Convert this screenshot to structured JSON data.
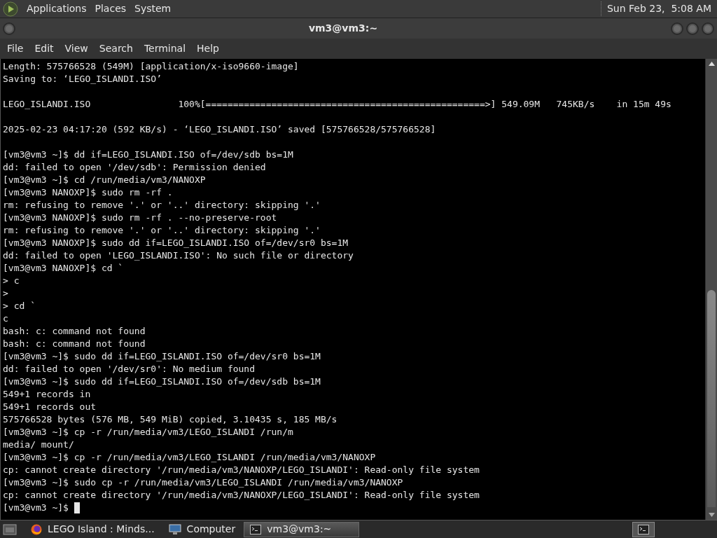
{
  "top_panel": {
    "menus": [
      "Applications",
      "Places",
      "System"
    ],
    "clock": "Sun Feb 23,  5:08 AM"
  },
  "window": {
    "title": "vm3@vm3:~"
  },
  "menu_bar": [
    "File",
    "Edit",
    "View",
    "Search",
    "Terminal",
    "Help"
  ],
  "terminal": {
    "lines": [
      {
        "kind": "text",
        "text": "Length: 575766528 (549M) [application/x-iso9660-image]"
      },
      {
        "kind": "text",
        "text": "Saving to: ‘LEGO_ISLANDI.ISO’"
      },
      {
        "kind": "blank"
      },
      {
        "kind": "text",
        "text": "LEGO_ISLANDI.ISO                100%[===================================================>] 549.09M   745KB/s    in 15m 49s"
      },
      {
        "kind": "blank"
      },
      {
        "kind": "text",
        "text": "2025-02-23 04:17:20 (592 KB/s) - ‘LEGO_ISLANDI.ISO’ saved [575766528/575766528]"
      },
      {
        "kind": "blank"
      },
      {
        "kind": "text",
        "text": "[vm3@vm3 ~]$ dd if=LEGO_ISLANDI.ISO of=/dev/sdb bs=1M"
      },
      {
        "kind": "text",
        "text": "dd: failed to open '/dev/sdb': Permission denied"
      },
      {
        "kind": "text",
        "text": "[vm3@vm3 ~]$ cd /run/media/vm3/NANOXP"
      },
      {
        "kind": "text",
        "text": "[vm3@vm3 NANOXP]$ sudo rm -rf ."
      },
      {
        "kind": "text",
        "text": "rm: refusing to remove '.' or '..' directory: skipping '.'"
      },
      {
        "kind": "text",
        "text": "[vm3@vm3 NANOXP]$ sudo rm -rf . --no-preserve-root"
      },
      {
        "kind": "text",
        "text": "rm: refusing to remove '.' or '..' directory: skipping '.'"
      },
      {
        "kind": "text",
        "text": "[vm3@vm3 NANOXP]$ sudo dd if=LEGO_ISLANDI.ISO of=/dev/sr0 bs=1M"
      },
      {
        "kind": "text",
        "text": "dd: failed to open 'LEGO_ISLANDI.ISO': No such file or directory"
      },
      {
        "kind": "text",
        "text": "[vm3@vm3 NANOXP]$ cd `"
      },
      {
        "kind": "text",
        "text": "> c"
      },
      {
        "kind": "text",
        "text": ">"
      },
      {
        "kind": "text",
        "text": "> cd `"
      },
      {
        "kind": "text",
        "text": "c"
      },
      {
        "kind": "text",
        "text": "bash: c: command not found"
      },
      {
        "kind": "text",
        "text": "bash: c: command not found"
      },
      {
        "kind": "text",
        "text": "[vm3@vm3 ~]$ sudo dd if=LEGO_ISLANDI.ISO of=/dev/sr0 bs=1M"
      },
      {
        "kind": "text",
        "text": "dd: failed to open '/dev/sr0': No medium found"
      },
      {
        "kind": "text",
        "text": "[vm3@vm3 ~]$ sudo dd if=LEGO_ISLANDI.ISO of=/dev/sdb bs=1M"
      },
      {
        "kind": "text",
        "text": "549+1 records in"
      },
      {
        "kind": "text",
        "text": "549+1 records out"
      },
      {
        "kind": "text",
        "text": "575766528 bytes (576 MB, 549 MiB) copied, 3.10435 s, 185 MB/s"
      },
      {
        "kind": "text",
        "text": "[vm3@vm3 ~]$ cp -r /run/media/vm3/LEGO_ISLANDI /run/m"
      },
      {
        "kind": "text",
        "text": "media/ mount/"
      },
      {
        "kind": "text",
        "text": "[vm3@vm3 ~]$ cp -r /run/media/vm3/LEGO_ISLANDI /run/media/vm3/NANOXP"
      },
      {
        "kind": "text",
        "text": "cp: cannot create directory '/run/media/vm3/NANOXP/LEGO_ISLANDI': Read-only file system"
      },
      {
        "kind": "text",
        "text": "[vm3@vm3 ~]$ sudo cp -r /run/media/vm3/LEGO_ISLANDI /run/media/vm3/NANOXP"
      },
      {
        "kind": "text",
        "text": "cp: cannot create directory '/run/media/vm3/NANOXP/LEGO_ISLANDI': Read-only file system"
      },
      {
        "kind": "prompt",
        "text": "[vm3@vm3 ~]$"
      }
    ]
  },
  "taskbar": {
    "items": [
      {
        "kind": "browser",
        "label": "LEGO Island : Minds...",
        "selected": false
      },
      {
        "kind": "computer",
        "label": "Computer",
        "selected": false
      },
      {
        "kind": "terminal",
        "label": "vm3@vm3:~",
        "selected": true
      }
    ]
  }
}
